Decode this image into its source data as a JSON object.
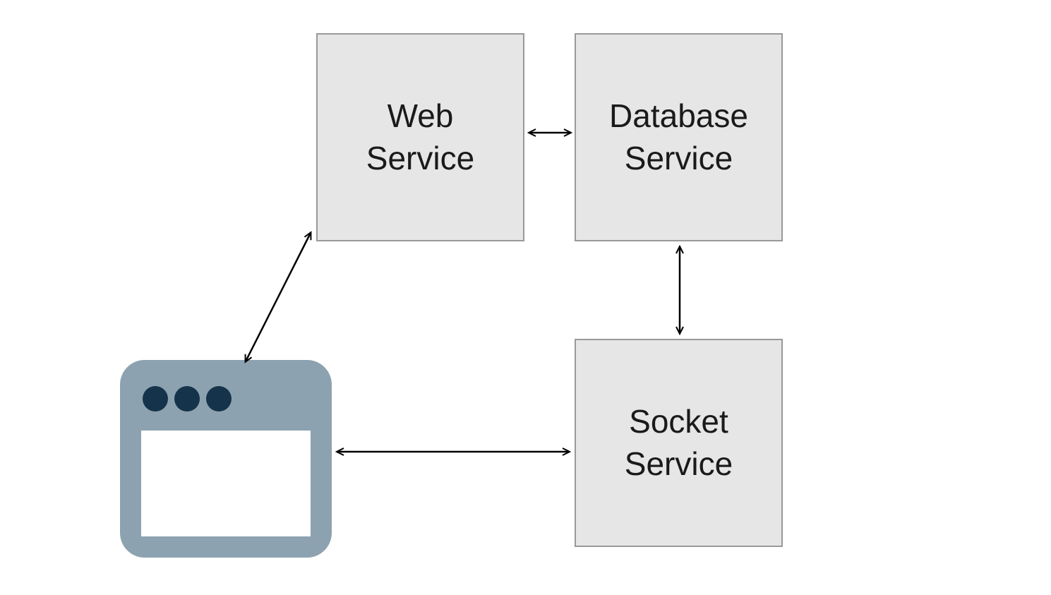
{
  "nodes": {
    "web_service": {
      "label": "Web\nService"
    },
    "database_service": {
      "label": "Database\nService"
    },
    "socket_service": {
      "label": "Socket\nService"
    },
    "browser": {
      "name": "browser-window-icon"
    }
  },
  "connections": [
    {
      "from": "browser",
      "to": "web_service",
      "bidirectional": true
    },
    {
      "from": "web_service",
      "to": "database_service",
      "bidirectional": true
    },
    {
      "from": "database_service",
      "to": "socket_service",
      "bidirectional": true
    },
    {
      "from": "browser",
      "to": "socket_service",
      "bidirectional": true
    }
  ],
  "colors": {
    "box_fill": "#e6e6e6",
    "box_border": "#999999",
    "arrow": "#000000",
    "browser_frame": "#8da2b0",
    "browser_dots": "#15334a",
    "browser_body": "#ffffff"
  }
}
